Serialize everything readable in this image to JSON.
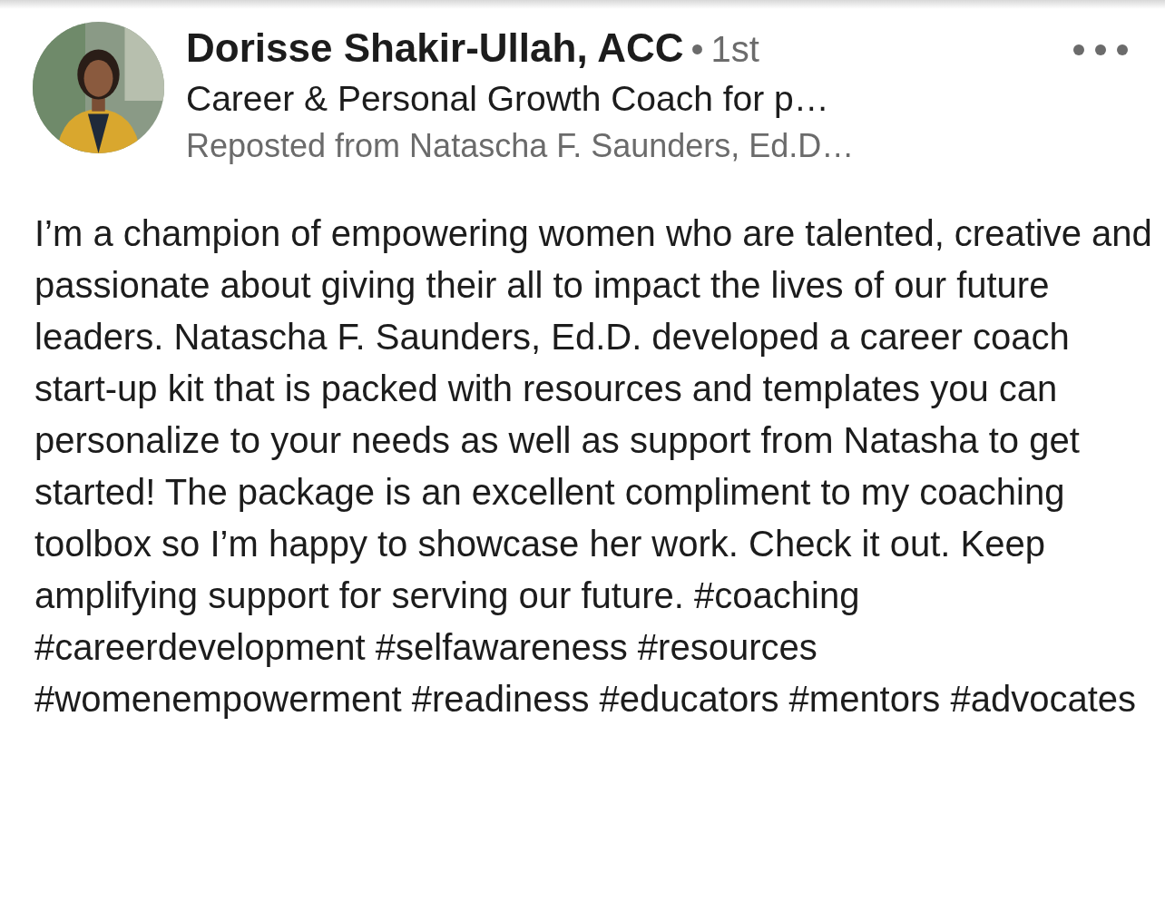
{
  "post": {
    "author": {
      "name": "Dorisse Shakir-Ullah, ACC",
      "separator": "•",
      "degree": "1st",
      "headline": "Career & Personal Growth Coach for p…",
      "repost_note": "Reposted from Natascha F. Saunders, Ed.D…"
    },
    "body": "I’m a champion of empowering women who are talented, creative and passionate about giving their all to impact the lives of our future leaders. Natascha F. Saunders, Ed.D. developed a career coach start-up kit that is packed with resources and templates you can personalize to your needs as well as support from Natasha to get started! The package is an excellent compliment to my coaching toolbox so I’m happy to showcase her work. Check it out. Keep amplifying support for serving our future. #coaching #careerdevelopment #selfawareness #resources #womenempowerment #readiness #educators #mentors #advocates"
  }
}
